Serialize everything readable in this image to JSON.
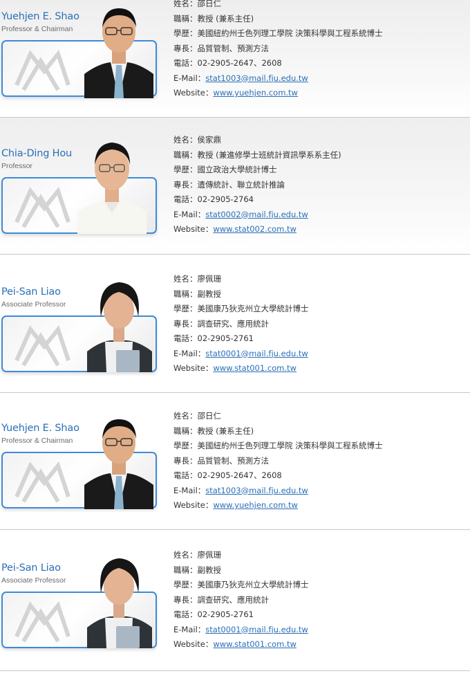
{
  "labels": {
    "name": "姓名：",
    "position": "職稱：",
    "education": "學歷：",
    "specialty": "專長：",
    "phone": "電話：",
    "email": "E-Mail：",
    "website": "Website："
  },
  "entries": [
    {
      "name_en": "Yuehjen E. Shao",
      "title_en": "Professor & Chairman",
      "name_zh": "邵日仁",
      "position": "教授 (兼系主任)",
      "education": "美國紐約州壬色列理工學院 決策科學與工程系統博士",
      "specialty": "品質管制、預測方法",
      "phone": "02-2905-2647、2608",
      "email": "stat1003@mail.fju.edu.tw",
      "website": "www.yuehjen.com.tw"
    },
    {
      "name_en": "Chia-Ding Hou",
      "title_en": "Professor",
      "name_zh": "侯家鼎",
      "position": "教授 (兼進修學士班統計資訊學系系主任)",
      "education": "國立政治大學統計博士",
      "specialty": "遺傳統計、聯立統計推論",
      "phone": "02-2905-2764",
      "email": "stat0002@mail.fju.edu.tw",
      "website": "www.stat002.com.tw"
    },
    {
      "name_en": "Pei-San Liao",
      "title_en": "Associate Professor",
      "name_zh": "廖佩珊",
      "position": "副教授",
      "education": "美國康乃狄克州立大學統計博士",
      "specialty": "調查研究、應用統計",
      "phone": "02-2905-2761",
      "email": "stat0001@mail.fju.edu.tw",
      "website": "www.stat001.com.tw"
    },
    {
      "name_en": "Yuehjen E. Shao",
      "title_en": "Professor & Chairman",
      "name_zh": "邵日仁",
      "position": "教授 (兼系主任)",
      "education": "美國紐約州壬色列理工學院 決策科學與工程系統博士",
      "specialty": "品質管制、預測方法",
      "phone": "02-2905-2647、2608",
      "email": "stat1003@mail.fju.edu.tw",
      "website": "www.yuehjen.com.tw"
    },
    {
      "name_en": "Pei-San Liao",
      "title_en": "Associate Professor",
      "name_zh": "廖佩珊",
      "position": "副教授",
      "education": "美國康乃狄克州立大學統計博士",
      "specialty": "調查研究、應用統計",
      "phone": "02-2905-2761",
      "email": "stat0001@mail.fju.edu.tw",
      "website": "www.stat001.com.tw"
    }
  ],
  "colors": {
    "accent": "#2a6fb8",
    "card_border": "#3d8ad8"
  }
}
